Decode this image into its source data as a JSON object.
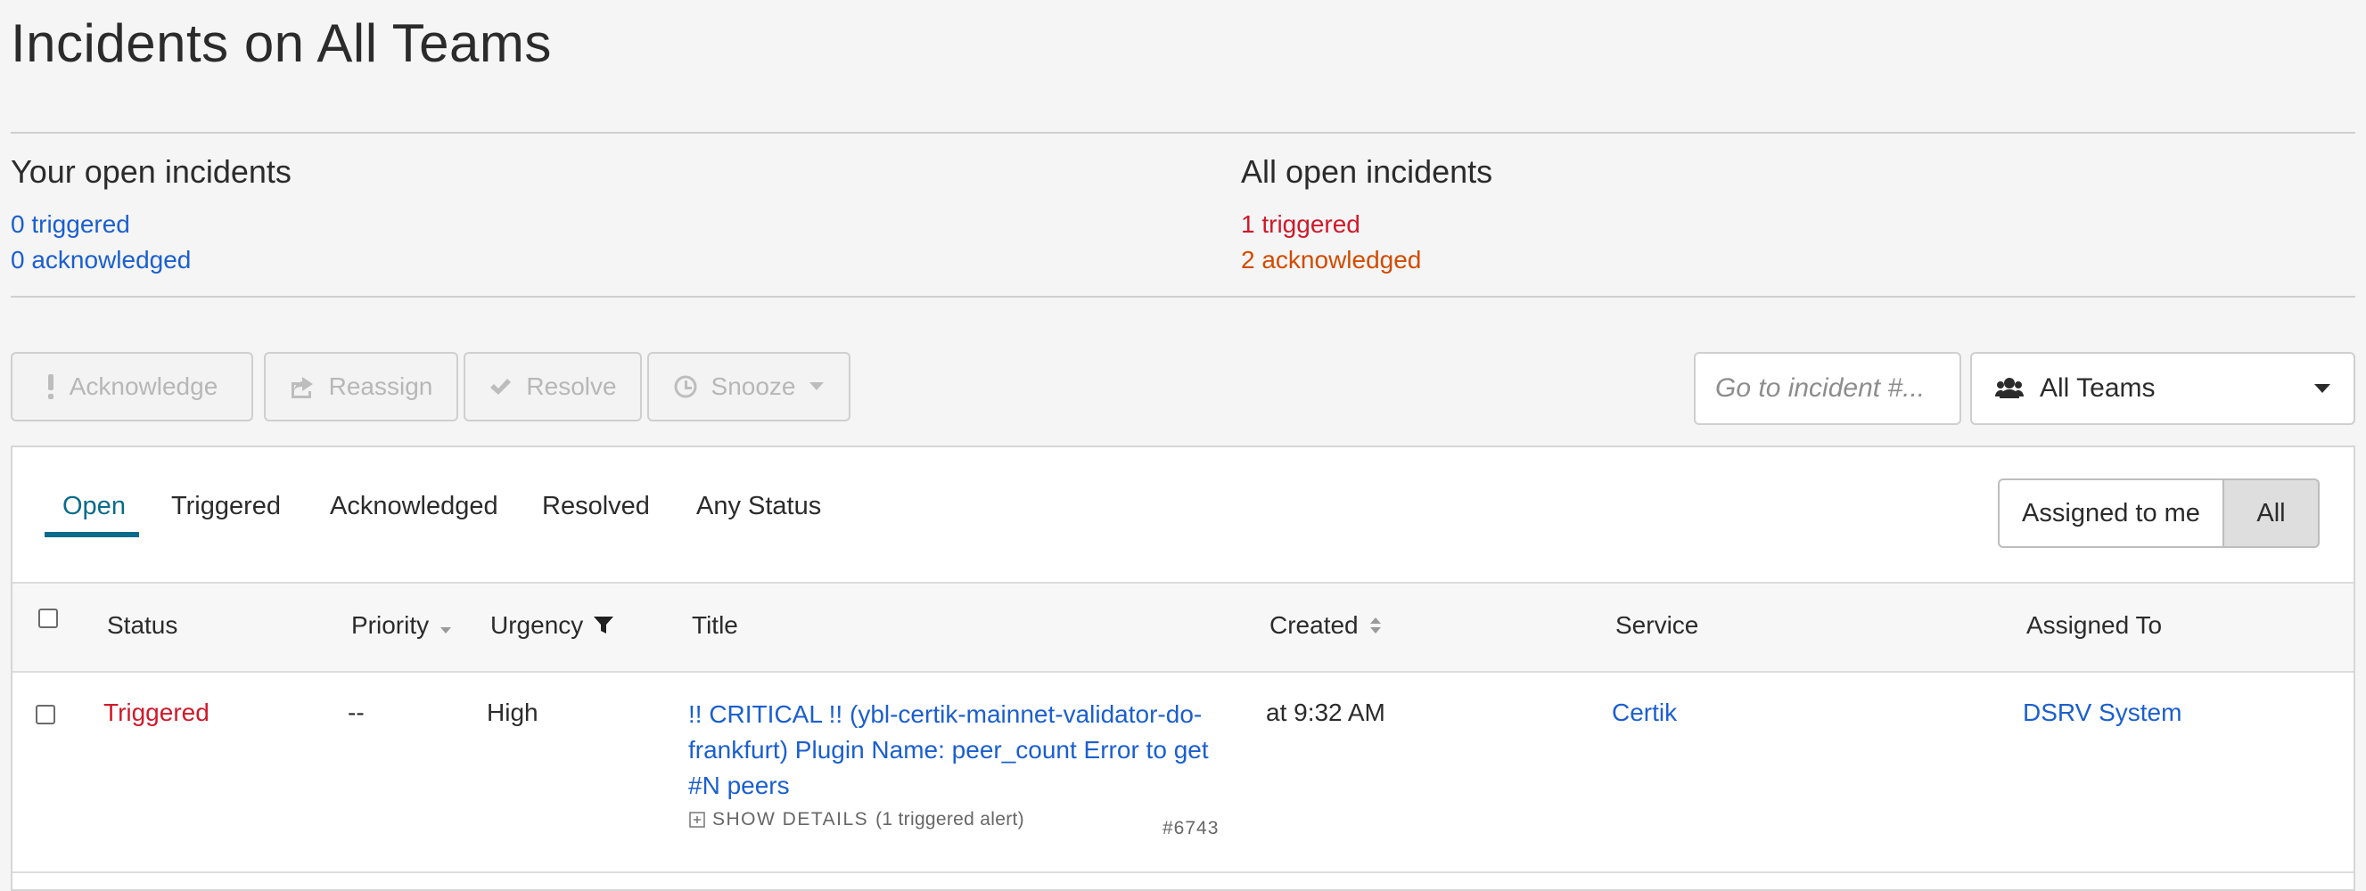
{
  "page": {
    "title": "Incidents on All Teams"
  },
  "summary": {
    "yours": {
      "heading": "Your open incidents",
      "triggered": "0 triggered",
      "acknowledged": "0 acknowledged"
    },
    "all": {
      "heading": "All open incidents",
      "triggered": "1 triggered",
      "acknowledged": "2 acknowledged"
    }
  },
  "toolbar": {
    "acknowledge": "Acknowledge",
    "reassign": "Reassign",
    "resolve": "Resolve",
    "snooze": "Snooze",
    "goto_placeholder": "Go to incident #...",
    "team_filter": "All Teams"
  },
  "tabs": [
    {
      "label": "Open"
    },
    {
      "label": "Triggered"
    },
    {
      "label": "Acknowledged"
    },
    {
      "label": "Resolved"
    },
    {
      "label": "Any Status"
    }
  ],
  "assignment_toggle": {
    "mine": "Assigned to me",
    "all": "All"
  },
  "table": {
    "headers": {
      "status": "Status",
      "priority": "Priority",
      "urgency": "Urgency",
      "title": "Title",
      "created": "Created",
      "service": "Service",
      "assigned_to": "Assigned To"
    },
    "rows": [
      {
        "status": "Triggered",
        "priority": "--",
        "urgency": "High",
        "title": "!! CRITICAL !! (ybl-certik-mainnet-validator-do-frankfurt) Plugin Name: peer_count Error to get #N peers",
        "show_details": "SHOW DETAILS",
        "alerts": "(1 triggered alert)",
        "number": "#6743",
        "created": "at 9:32 AM",
        "service": "Certik",
        "assigned_to": "DSRV System"
      }
    ]
  },
  "colors": {
    "link": "#1b5fcf",
    "triggered": "#d0192b",
    "acknowledged": "#d24b00",
    "accent": "#0a6b8a"
  }
}
